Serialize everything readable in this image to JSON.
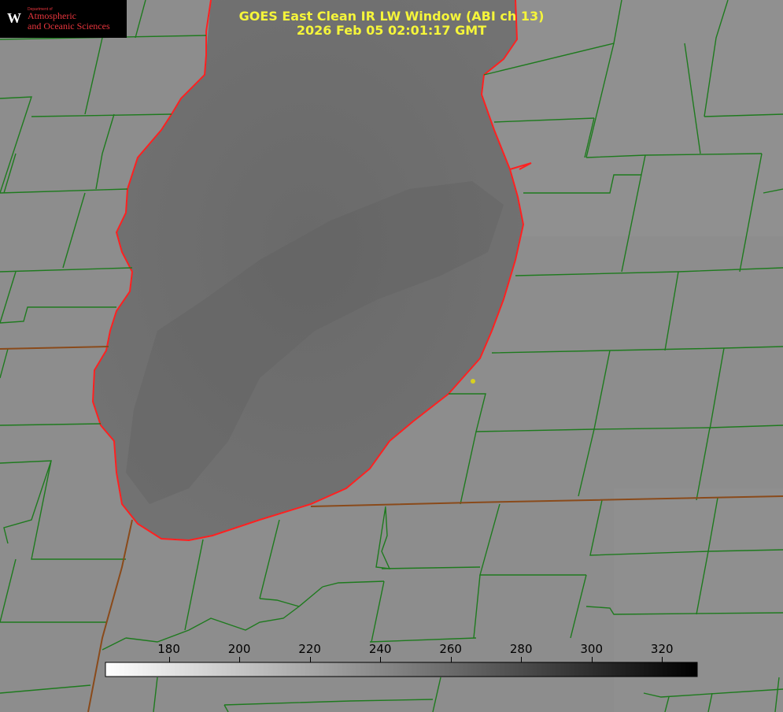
{
  "title": {
    "line1": "GOES East Clean IR LW Window (ABI ch 13)",
    "line2": "2026 Feb 05 02:01:17 GMT",
    "color": "#f5f53a"
  },
  "logo": {
    "dept_small": "Department of",
    "line1": "Atmospheric",
    "line2": "and Oceanic Sciences",
    "crest_letter": "W",
    "color": "#e8353d"
  },
  "colorbar": {
    "min": 162,
    "max": 330,
    "ticks": [
      "180",
      "200",
      "220",
      "240",
      "260",
      "280",
      "300",
      "320"
    ],
    "start_color": "#ffffff",
    "end_color": "#000000"
  },
  "map_colors": {
    "background": "#8c8c8c",
    "lake": "#6e6e6e",
    "county_lines": "#1e7a1e",
    "state_lines": "#8a4a1a",
    "coastline": "#ff2020",
    "marker": "#d8d020"
  }
}
